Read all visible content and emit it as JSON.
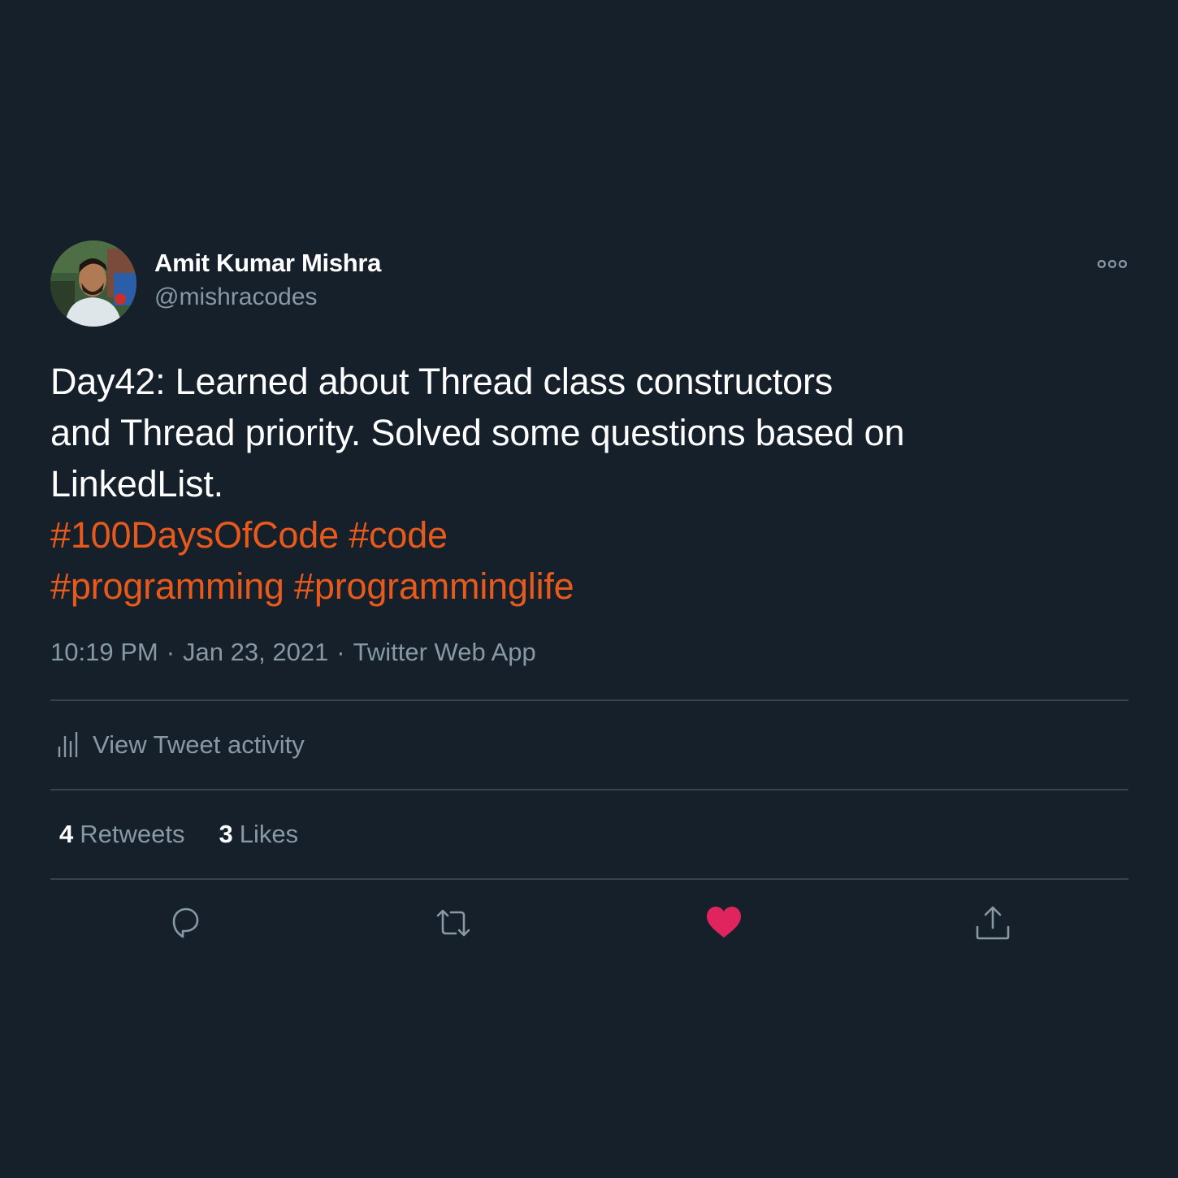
{
  "author": {
    "name": "Amit Kumar Mishra",
    "handle": "@mishracodes"
  },
  "tweet": {
    "text_lines": [
      "Day42: Learned about Thread class constructors",
      "and Thread priority. Solved some questions based on",
      "LinkedList."
    ],
    "hashtags": [
      "#100DaysOfCode",
      "#code",
      "#programming",
      "#programminglife"
    ]
  },
  "meta": {
    "time": "10:19 PM",
    "date": "Jan 23, 2021",
    "source": "Twitter Web App",
    "separator": "·"
  },
  "activity": {
    "label": "View Tweet activity",
    "icon": "bar-chart-icon"
  },
  "stats": {
    "retweets_count": "4",
    "retweets_label": "Retweets",
    "likes_count": "3",
    "likes_label": "Likes"
  },
  "actions": {
    "icons": [
      "reply-icon",
      "retweet-icon",
      "like-icon",
      "share-icon"
    ]
  },
  "colors": {
    "background": "#15202b",
    "text_primary": "#ffffff",
    "text_secondary": "#8899a6",
    "hashtag": "#e8591c",
    "divider": "#38444d",
    "like_active": "#e0245e"
  }
}
